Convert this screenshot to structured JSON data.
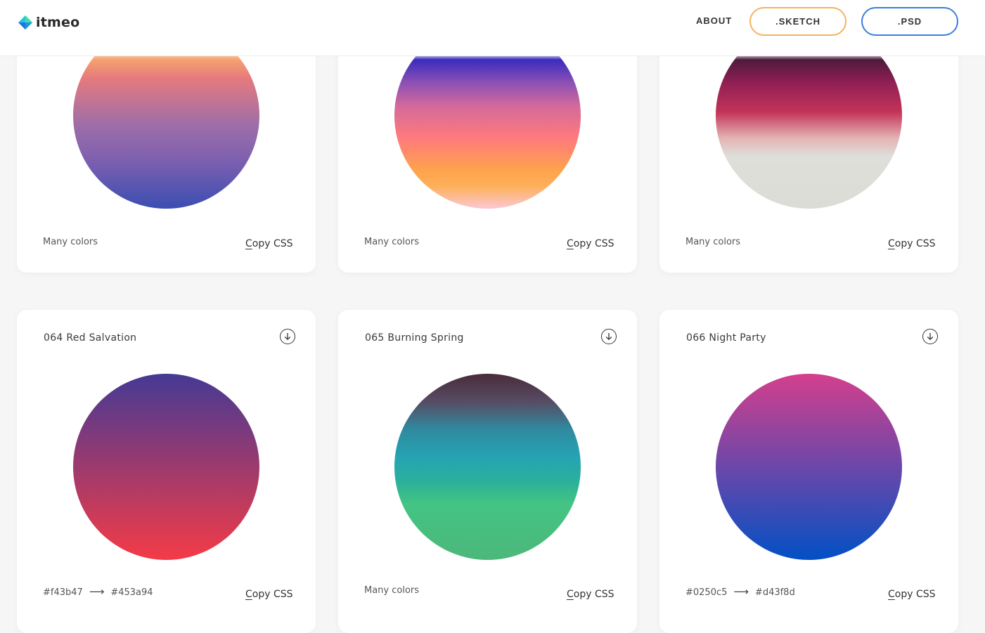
{
  "header": {
    "logo_text": "itmeo",
    "nav": {
      "about": "ABOUT",
      "sketch": ".SKETCH",
      "psd": ".PSD"
    },
    "colors": {
      "sketch_border": "#f5b25e",
      "psd_border": "#3a7fdc"
    }
  },
  "copy_label_first": "C",
  "copy_label_rest": "opy CSS",
  "cards_top": [
    {
      "description": "Many colors",
      "gradient": "linear-gradient(to bottom, #fff1eb 0%, #fbe7da 15%, #f6a16e 20%, #e57a7e 30%, #9e6ea8 55%, #7b5fb0 75%, #3b4eb1 100%)"
    },
    {
      "description": "Many colors",
      "gradient": "linear-gradient(to bottom, #e8e8f5 0%, #e6e7f3 17%, #3a2cbc 20%, #8a4fb6 32%, #d46a9b 45%, #ff7a7c 62%, #fda44c 80%, #fdb05a 88%, #fcc7d3 100%)"
    },
    {
      "description": "Many colors",
      "gradient": "linear-gradient(to bottom, #efefef 0%, #e8e6e6 17%, #4e1a3c 20%, #8f1f54 32%, #c33358 48%, #e3b3b3 62%, #dedfda 72%, #dcdcd6 100%)"
    }
  ],
  "cards_bottom": [
    {
      "title": "064 Red Salvation",
      "desc_from": "#f43b47",
      "desc_arrow": "⟶",
      "desc_to": "#453a94",
      "gradient": "linear-gradient(to top, #f43b47 0%, #453a94 100%)"
    },
    {
      "title": "065 Burning Spring",
      "description": "Many colors",
      "gradient": "linear-gradient(to bottom, #4a2c3a 0%, #574c64 15%, #2f8a9f 30%, #26a3b4 45%, #2aaf9c 57%, #43c482 70%, #4cb87a 100%)"
    },
    {
      "title": "066 Night Party",
      "desc_from": "#0250c5",
      "desc_arrow": "⟶",
      "desc_to": "#d43f8d",
      "gradient": "linear-gradient(to top, #0250c5 0%, #d43f8d 100%)"
    }
  ]
}
